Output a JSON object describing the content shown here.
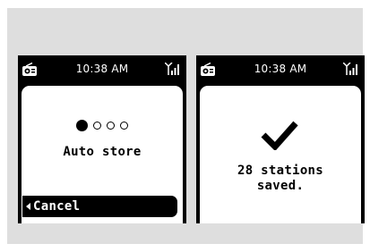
{
  "screens": [
    {
      "status": {
        "time": "10:38 AM",
        "left_icon": "radio-icon",
        "right_icon": "signal-icon"
      },
      "progress": {
        "total": 4,
        "current": 1
      },
      "title": "Auto store",
      "cancel_label": "Cancel"
    },
    {
      "status": {
        "time": "10:38 AM",
        "left_icon": "radio-icon",
        "right_icon": "signal-icon"
      },
      "icon": "checkmark-icon",
      "message_line1": "28 stations",
      "message_line2": "saved."
    }
  ],
  "colors": {
    "background": "#dedede",
    "screen": "#000000",
    "content": "#ffffff"
  }
}
